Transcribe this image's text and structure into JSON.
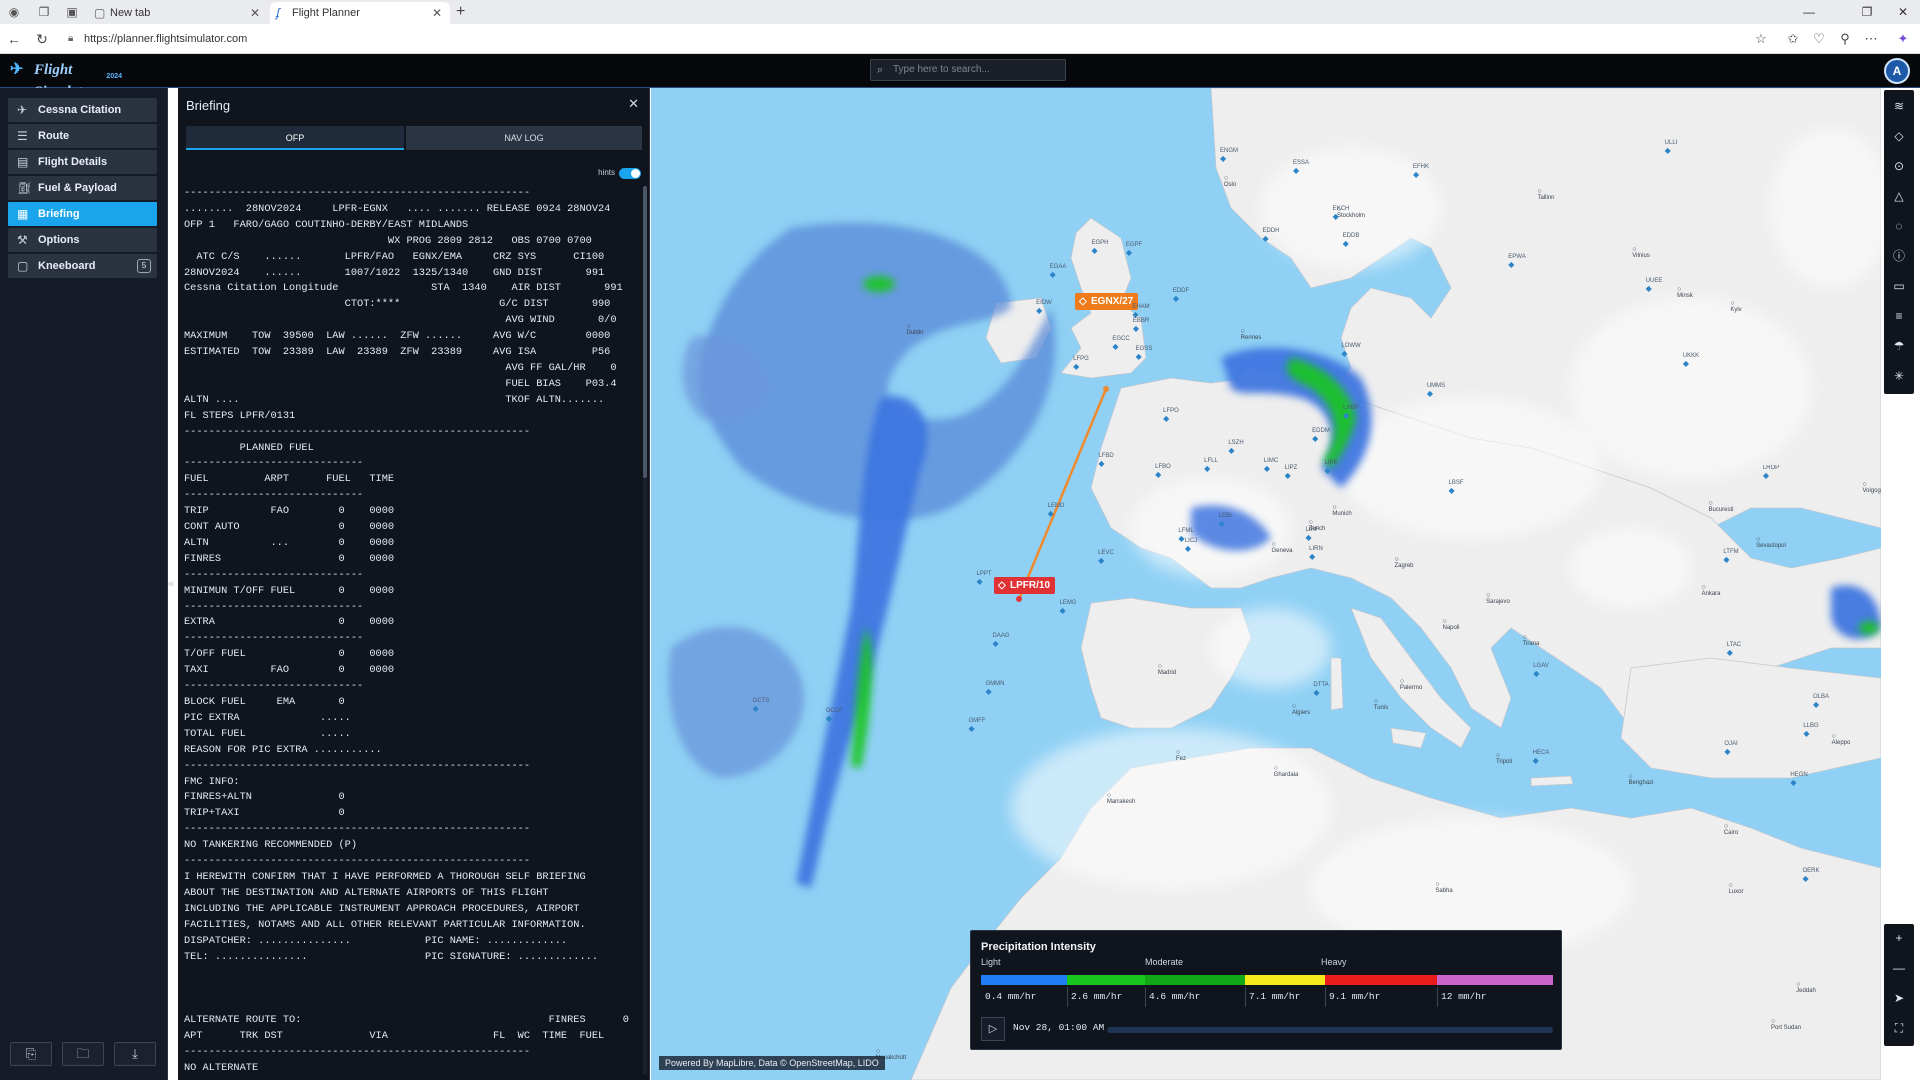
{
  "browser": {
    "tabs": [
      {
        "title": "New tab",
        "icon": "page-icon",
        "active": false
      },
      {
        "title": "Flight Planner",
        "icon": "fs-logo-icon",
        "active": true
      }
    ],
    "url": "https://planner.flightsimulator.com"
  },
  "app": {
    "logo_text": "Flight Simulator",
    "logo_year": "2024",
    "search_placeholder": "Type here to search..."
  },
  "sidebar": {
    "items": [
      {
        "label": "Cessna Citation Long...",
        "icon": "aircraft-icon",
        "active": false
      },
      {
        "label": "Route",
        "icon": "route-icon",
        "active": false
      },
      {
        "label": "Flight Details",
        "icon": "details-icon",
        "active": false
      },
      {
        "label": "Fuel & Payload",
        "icon": "fuel-icon",
        "active": false
      },
      {
        "label": "Briefing",
        "icon": "briefing-icon",
        "active": true
      },
      {
        "label": "Options",
        "icon": "wrench-icon",
        "active": false
      },
      {
        "label": "Kneeboard",
        "icon": "clipboard-icon",
        "active": false,
        "badge": "5"
      }
    ]
  },
  "briefing": {
    "title": "Briefing",
    "tabs": [
      "OFP",
      "NAV LOG"
    ],
    "hints_label": "hints",
    "hints_on": true,
    "ofp_lines": [
      "--------------------------------------------------------",
      "........  28NOV2024     LPFR-EGNX   .... ....... RELEASE 0924 28NOV24",
      "OFP 1   FARO/GAGO COUTINHO-DERBY/EAST MIDLANDS",
      "                                 WX PROG 2809 2812   OBS 0700 0700",
      "  ATC C/S    ......       LPFR/FAO   EGNX/EMA     CRZ SYS      CI100",
      "28NOV2024    ......       1007/1022  1325/1340    GND DIST       991",
      "Cessna Citation Longitude               STA  1340    AIR DIST       991",
      "                          CTOT:****                G/C DIST       990",
      "                                                    AVG WIND       0/0",
      "MAXIMUM    TOW  39500  LAW ......  ZFW ......     AVG W/C        0000",
      "ESTIMATED  TOW  23389  LAW  23389  ZFW  23389     AVG ISA         P56",
      "                                                    AVG FF GAL/HR    0",
      "                                                    FUEL BIAS    P03.4",
      "ALTN ....                                           TKOF ALTN.......",
      "FL STEPS LPFR/0131",
      "--------------------------------------------------------",
      "         PLANNED FUEL",
      "-----------------------------",
      "FUEL         ARPT      FUEL   TIME",
      "-----------------------------",
      "TRIP          FAO        0    0000",
      "CONT AUTO                0    0000",
      "ALTN          ...        0    0000",
      "FINRES                   0    0000",
      "-----------------------------",
      "MINIMUN T/OFF FUEL       0    0000",
      "-----------------------------",
      "EXTRA                    0    0000",
      "-----------------------------",
      "T/OFF FUEL               0    0000",
      "TAXI          FAO        0    0000",
      "-----------------------------",
      "BLOCK FUEL     EMA       0",
      "PIC EXTRA             .....",
      "TOTAL FUEL            .....",
      "REASON FOR PIC EXTRA ...........",
      "--------------------------------------------------------",
      "FMC INFO:",
      "FINRES+ALTN              0",
      "TRIP+TAXI                0",
      "--------------------------------------------------------",
      "NO TANKERING RECOMMENDED (P)",
      "--------------------------------------------------------",
      "I HEREWITH CONFIRM THAT I HAVE PERFORMED A THOROUGH SELF BRIEFING",
      "ABOUT THE DESTINATION AND ALTERNATE AIRPORTS OF THIS FLIGHT",
      "INCLUDING THE APPLICABLE INSTRUMENT APPROACH PROCEDURES, AIRPORT",
      "FACILITIES, NOTAMS AND ALL OTHER RELEVANT PARTICULAR INFORMATION.",
      "DISPATCHER: ...............            PIC NAME: .............",
      "TEL: ...............                   PIC SIGNATURE: .............",
      "",
      "",
      "",
      "ALTERNATE ROUTE TO:                                        FINRES      0",
      "APT      TRK DST              VIA                 FL  WC  TIME  FUEL",
      "--------------------------------------------------------",
      "NO ALTERNATE"
    ]
  },
  "map": {
    "attribution": "Powered By MapLibre, Data © OpenStreetMap, LIDO",
    "origin": "LPFR/10",
    "destination": "EGNX/27",
    "airports": [
      "ENGM",
      "ESSA",
      "EFHK",
      "ULLI",
      "EKCH",
      "EGPH",
      "EGPF",
      "EGAA",
      "EIDW",
      "EGCC",
      "EGSS",
      "EHAM",
      "EDDH",
      "EDDB",
      "EPWA",
      "EDDF",
      "EBBR",
      "LFPG",
      "LFPO",
      "EDDM",
      "LSZH",
      "LFLL",
      "LOWW",
      "LHBP",
      "LIMC",
      "LIPZ",
      "LIPE",
      "LFBO",
      "LFBD",
      "LFML",
      "LIRF",
      "LIRN",
      "LEBL",
      "LEMD",
      "LPPT",
      "LEVC",
      "LEMG",
      "LICJ",
      "LGAV",
      "LTFM",
      "LTAC",
      "LBSF",
      "LROP",
      "UKBB",
      "UUEE",
      "UMMS",
      "UKKK",
      "DAAG",
      "GMFF",
      "GMMN",
      "GCTS",
      "GCLP",
      "DTTA",
      "HECA",
      "OJAI",
      "LLBG",
      "OLBA",
      "HEGN",
      "OERK"
    ],
    "cities": [
      "Oslo",
      "Stockholm",
      "Tallinn",
      "Vilnius",
      "Minsk",
      "Kyiv",
      "Dublin",
      "Munich",
      "Zurich",
      "Geneva",
      "Zagreb",
      "Sarajevo",
      "Bucuresti",
      "Sevastopol",
      "Tirana",
      "Napoli",
      "Ankara",
      "Madrid",
      "Algiers",
      "Tunis",
      "Palermo",
      "Fez",
      "Marrakesh",
      "Tripoli",
      "Benghazi",
      "Ghardaia",
      "Aleppo",
      "Cairo",
      "Luxor",
      "Jeddah",
      "Sabha",
      "Port Sudan",
      "Nouakchott",
      "Volgograd",
      "Rennes"
    ],
    "legend": {
      "title": "Precipitation Intensity",
      "levels": [
        "Light",
        "Moderate",
        "Heavy"
      ],
      "values": [
        "0.4 mm/hr",
        "2.6 mm/hr",
        "4.6 mm/hr",
        "7.1 mm/hr",
        "9.1 mm/hr",
        "12 mm/hr"
      ],
      "colors": [
        "#1f7cf2",
        "#19c51f",
        "#12a818",
        "#f4e91b",
        "#ec1b1b",
        "#cc63c8"
      ],
      "time": "Nov 28, 01:00 AM"
    }
  },
  "toolbar": {
    "icons": [
      "layers-icon",
      "waypoint-icon",
      "vor-icon",
      "ndb-icon",
      "fix-icon",
      "info-icon",
      "card-icon",
      "wind-icon",
      "weather-icon",
      "settings-icon"
    ],
    "zoom": [
      "zoom-in-icon",
      "zoom-out-icon",
      "locate-icon",
      "fullscreen-icon"
    ]
  }
}
